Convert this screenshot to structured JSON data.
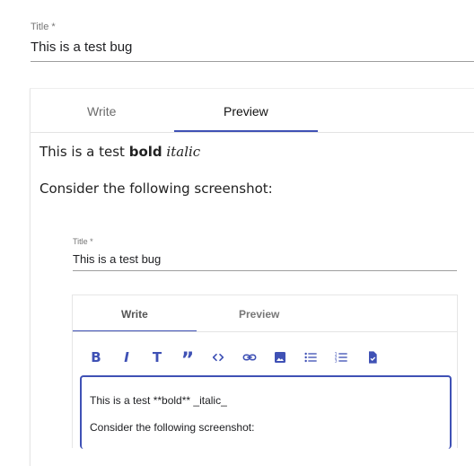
{
  "form": {
    "title_label": "Title *",
    "title_value": "This is a test bug"
  },
  "editor_tabs": {
    "write_label": "Write",
    "preview_label": "Preview",
    "active": "Preview"
  },
  "preview": {
    "line1_prefix": "This is a test ",
    "line1_bold": "bold",
    "line1_italic": "italic",
    "line2": "Consider the following screenshot:"
  },
  "embedded": {
    "title_label": "Title *",
    "title_value": "This is a test bug",
    "tabs": {
      "write_label": "Write",
      "preview_label": "Preview",
      "active": "Write"
    },
    "toolbar": [
      "bold",
      "italic",
      "heading",
      "quote",
      "code",
      "link",
      "image",
      "bulleted-list",
      "numbered-list",
      "task-list"
    ],
    "toolbar_bold_glyph": "B",
    "toolbar_italic_glyph": "I",
    "toolbar_heading_glyph": "T",
    "toolbar_quote_glyph": "”",
    "editor_line1": "This is a test **bold** _italic_",
    "editor_line2": "Consider the following screenshot:"
  },
  "colors": {
    "accent": "#3f51b5",
    "label": "#757575"
  }
}
